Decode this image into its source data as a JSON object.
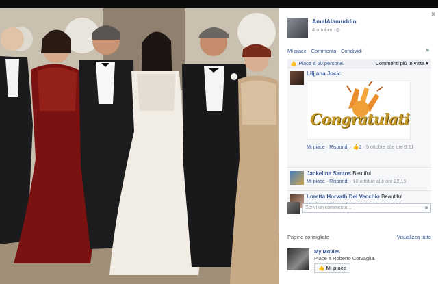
{
  "photo": {
    "alt": ""
  },
  "window": {
    "close": "×"
  },
  "post": {
    "author": "AmalAlamuddin",
    "date": "4 ottobre",
    "privacy_icon": "globe-icon",
    "actions": {
      "like": "Mi piace",
      "comment": "Commenta",
      "share": "Condividi",
      "sep": "·"
    }
  },
  "likes": {
    "text": "Piace a 50 persone.",
    "order": "Commenti più in vista ▾"
  },
  "comments": [
    {
      "name": "Liljjana Jocic",
      "text": "",
      "image_text": "Congratulation",
      "like": "Mi piace",
      "reply": "Rispondi",
      "likes_count": "2",
      "time": "5 ottobre alle ore 9.11"
    },
    {
      "name": "Jackeline Santos",
      "text": "Beutiful",
      "like": "Mi piace",
      "reply": "Rispondi",
      "time": "10 ottobre alle ore 22.16"
    },
    {
      "name": "Loretta Horvath Del Vecchio",
      "text": "Beautiful",
      "like": "Mi piace",
      "reply": "Rispondi",
      "time": "5 ottobre alle ore 5.44"
    }
  ],
  "write_comment": {
    "placeholder": "Scrivi un commento...",
    "camera_icon": "camera-icon"
  },
  "suggested": {
    "heading": "Pagine consigliate",
    "see_all": "Visualizza tutte",
    "page_name": "My Movies",
    "page_sub": "Piace a Roberto Corvaglia.",
    "like_button": "Mi piace"
  }
}
